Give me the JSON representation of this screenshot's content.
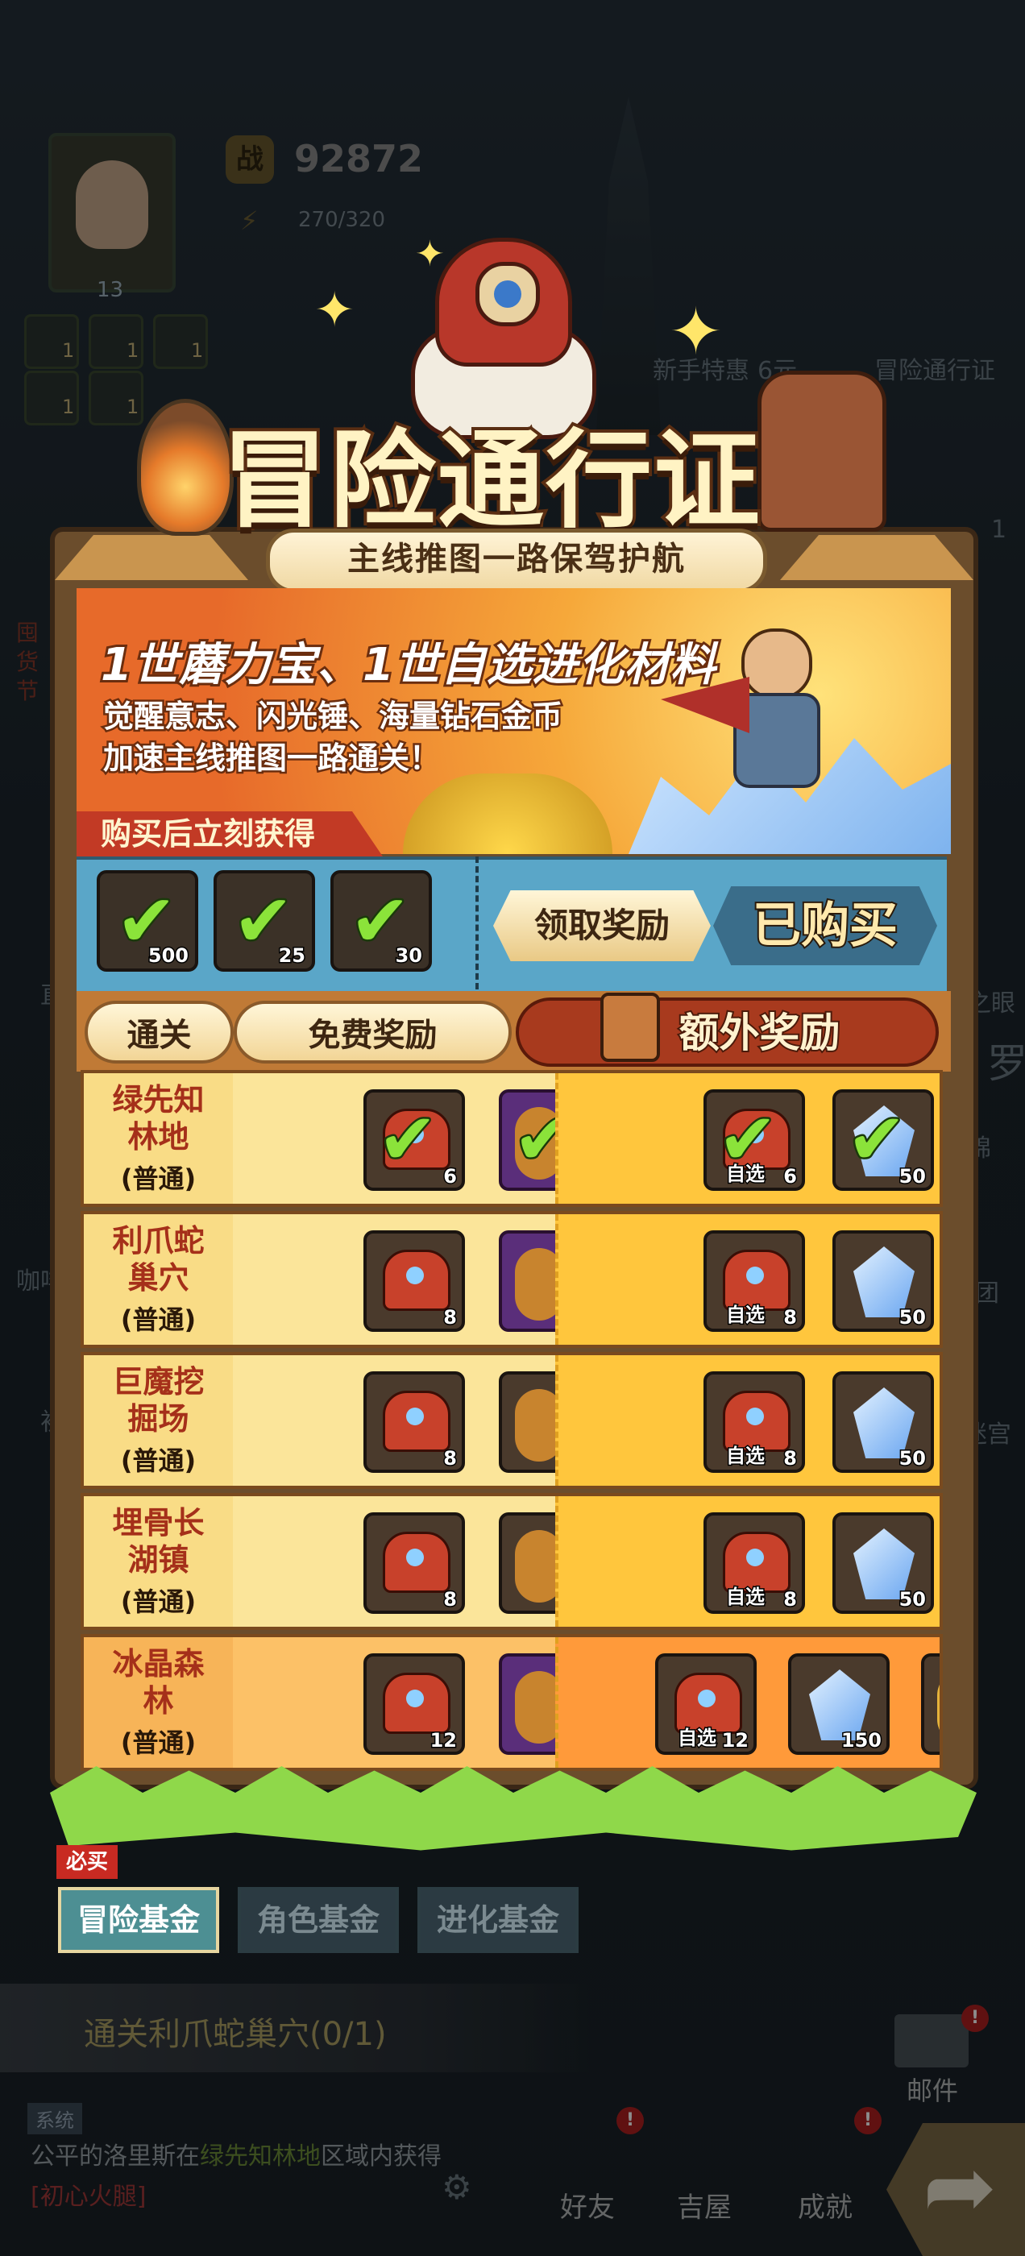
{
  "hud": {
    "level": "13",
    "score": "92872",
    "energy": "270/320",
    "score_icon_text": "战",
    "skills": [
      "1",
      "1",
      "1",
      "1",
      "1"
    ]
  },
  "background_events": [
    "新手特惠",
    "6元",
    "冒险通行证",
    "1",
    "之眼",
    "罗",
    "锦",
    "团",
    "迷宫"
  ],
  "background_left": [
    "囤货节",
    "直",
    "咖啡",
    "初"
  ],
  "popup": {
    "title": "冒险通行证",
    "subtitle": "主线推图一路保驾护航",
    "banner_title": "1世蘑力宝、1世自选进化材料",
    "banner_line1": "觉醒意志、闪光锤、海量钻石金币",
    "banner_line2": "加速主线推图一路通关！",
    "buy_label": "购买后立刻获得",
    "buy_items": [
      "500",
      "25",
      "30"
    ],
    "claim_button": "领取奖励",
    "bought_button": "已购买",
    "headers": {
      "stage": "通关",
      "free": "免费奖励",
      "extra": "额外奖励"
    },
    "rows": [
      {
        "name": "绿先知林地",
        "diff": "(普通)",
        "free_count": "6",
        "paid1": "6",
        "paid1_sel": "自选",
        "paid2": "50",
        "claimed": true
      },
      {
        "name": "利爪蛇巢穴",
        "diff": "(普通)",
        "free_count": "8",
        "paid1": "8",
        "paid1_sel": "自选",
        "paid2": "50",
        "claimed": false
      },
      {
        "name": "巨魔挖掘场",
        "diff": "(普通)",
        "free_count": "8",
        "paid1": "8",
        "paid1_sel": "自选",
        "paid2": "50",
        "claimed": false
      },
      {
        "name": "埋骨长湖镇",
        "diff": "(普通)",
        "free_count": "8",
        "paid1": "8",
        "paid1_sel": "自选",
        "paid2": "50",
        "claimed": false
      },
      {
        "name": "冰晶森林",
        "diff": "(普通)",
        "free_count": "12",
        "paid1": "12",
        "paid1_sel": "自选",
        "paid2": "150",
        "claimed": false
      }
    ],
    "must_buy": "必买",
    "fund_tabs": [
      "冒险基金",
      "角色基金",
      "进化基金"
    ]
  },
  "quest": "通关利爪蛇巢穴(0/1)",
  "system": {
    "tag": "系统",
    "msg_pre": "公平的洛里斯在",
    "msg_place": "绿先知林地",
    "msg_mid": "区域内获得",
    "msg_item": "[初心火腿]"
  },
  "bottom_nav": [
    "好友",
    "吉屋",
    "成就"
  ],
  "mail_label": "邮件",
  "badge_text": "!"
}
